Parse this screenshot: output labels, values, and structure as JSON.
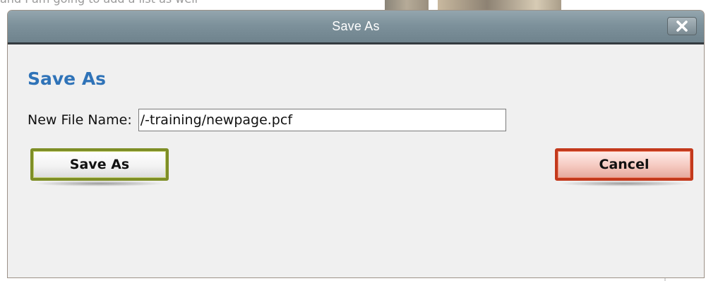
{
  "dialog": {
    "title": "Save As",
    "heading": "Save As",
    "field_label": "New File Name:",
    "file_name_value": "/-training/newpage.pcf",
    "save_button": "Save As",
    "cancel_button": "Cancel",
    "close_icon": "close-icon"
  },
  "background": {
    "partial_text": "and I am going to add a list as well"
  },
  "colors": {
    "heading": "#2f73b8",
    "titlebar": "#7d919b",
    "save_border": "#7e8e26",
    "cancel_border": "#c3391c"
  }
}
